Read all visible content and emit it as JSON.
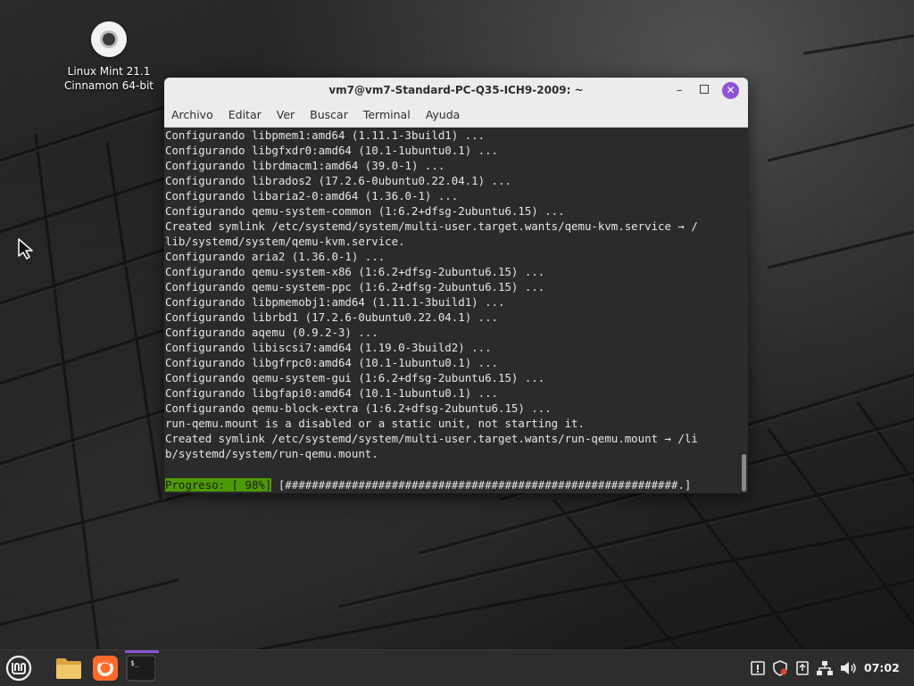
{
  "desktop": {
    "icon_label_line1": "Linux Mint 21.1",
    "icon_label_line2": "Cinnamon 64-bit"
  },
  "window": {
    "title": "vm7@vm7-Standard-PC-Q35-ICH9-2009: ~",
    "menu": [
      "Archivo",
      "Editar",
      "Ver",
      "Buscar",
      "Terminal",
      "Ayuda"
    ],
    "minimize_glyph": "–",
    "close_glyph": "✕"
  },
  "terminal": {
    "lines": [
      "Configurando libpmem1:amd64 (1.11.1-3build1) ...",
      "Configurando libgfxdr0:amd64 (10.1-1ubuntu0.1) ...",
      "Configurando librdmacm1:amd64 (39.0-1) ...",
      "Configurando librados2 (17.2.6-0ubuntu0.22.04.1) ...",
      "Configurando libaria2-0:amd64 (1.36.0-1) ...",
      "Configurando qemu-system-common (1:6.2+dfsg-2ubuntu6.15) ...",
      "Created symlink /etc/systemd/system/multi-user.target.wants/qemu-kvm.service → /",
      "lib/systemd/system/qemu-kvm.service.",
      "Configurando aria2 (1.36.0-1) ...",
      "Configurando qemu-system-x86 (1:6.2+dfsg-2ubuntu6.15) ...",
      "Configurando qemu-system-ppc (1:6.2+dfsg-2ubuntu6.15) ...",
      "Configurando libpmemobj1:amd64 (1.11.1-3build1) ...",
      "Configurando librbd1 (17.2.6-0ubuntu0.22.04.1) ...",
      "Configurando aqemu (0.9.2-3) ...",
      "Configurando libiscsi7:amd64 (1.19.0-3build2) ...",
      "Configurando libgfrpc0:amd64 (10.1-1ubuntu0.1) ...",
      "Configurando qemu-system-gui (1:6.2+dfsg-2ubuntu6.15) ...",
      "Configurando libgfapi0:amd64 (10.1-1ubuntu0.1) ...",
      "Configurando qemu-block-extra (1:6.2+dfsg-2ubuntu6.15) ...",
      "run-qemu.mount is a disabled or a static unit, not starting it.",
      "Created symlink /etc/systemd/system/multi-user.target.wants/run-qemu.mount → /li",
      "b/systemd/system/run-qemu.mount."
    ],
    "progress_label": "Progreso: [ 98%]",
    "progress_bar": " [###########################################################.]",
    "progress_percent": 98
  },
  "taskbar": {
    "clock": "07:02",
    "apps": [
      "mint-menu-icon",
      "files-folder-icon",
      "firefox-icon",
      "terminal-icon"
    ],
    "tray": [
      "notification-icon",
      "shield-icon",
      "clipboard-icon",
      "network-icon",
      "volume-icon"
    ]
  },
  "colors": {
    "accent": "#8d54d8",
    "progress_green": "#4e9a06",
    "terminal_bg": "#2b2b2b",
    "titlebar_bg": "#ececec"
  }
}
